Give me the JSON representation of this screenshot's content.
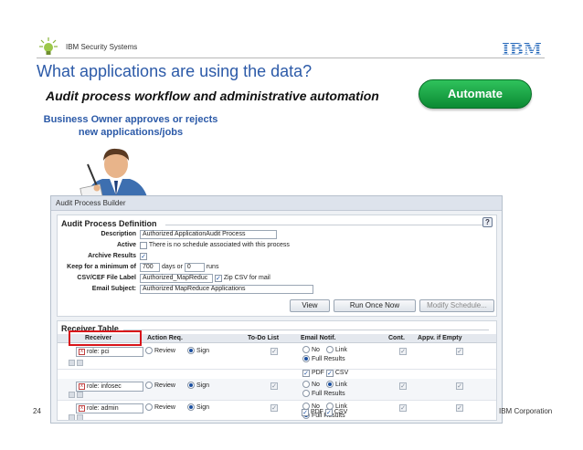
{
  "header": {
    "brand": "IBM Security Systems",
    "logo": "IBM",
    "title": "What applications are using the data?",
    "subtitle": "Audit process workflow and administrative automation",
    "badge": "Automate"
  },
  "owner_text": "Business Owner approves or rejects new applications/jobs",
  "footer": {
    "page": "24",
    "corp": "IBM Corporation"
  },
  "app": {
    "title": "Audit Process Builder",
    "definition": {
      "heading": "Audit Process Definition",
      "help": "?",
      "fields": {
        "description_label": "Description",
        "description_value": "Authorized ApplicationAudit Process",
        "active_label": "Active",
        "active_note": "There is no schedule associated with this process",
        "archive_label": "Archive Results",
        "keep_label": "Keep for a minimum of",
        "keep_days": "700",
        "days_or": "days or",
        "keep_runs": "0",
        "runs": "runs",
        "csv_label": "CSV/CEF File Label",
        "csv_value": "Authorized_MapReduc",
        "zip_label": "Zip CSV for mail",
        "email_label": "Email Subject:",
        "email_value": "Authorized MapReduce Applications"
      },
      "buttons": {
        "view": "View",
        "run_once": "Run Once Now",
        "modify": "Modify Schedule..."
      }
    },
    "receiver_table": {
      "heading": "Receiver Table",
      "columns": [
        "Receiver",
        "Action Req.",
        "To-Do List",
        "Email Notif.",
        "Cont.",
        "Appv. if Empty"
      ],
      "option_labels": {
        "review": "Review",
        "sign": "Sign",
        "no": "No",
        "link": "Link",
        "full": "Full Results",
        "pdf": "PDF",
        "csv": "CSV"
      },
      "rows": [
        {
          "receiver": "role: pci",
          "action": "Sign",
          "email": "Full Results"
        },
        {
          "receiver": "role: infosec",
          "action": "Sign",
          "email": "Link"
        },
        {
          "receiver": "role: admin",
          "action": "Sign",
          "email": "Full Results"
        }
      ]
    }
  },
  "colors": {
    "title": "#2c5aa8",
    "badge": "#1aa648",
    "highlight": "#d8141a"
  }
}
